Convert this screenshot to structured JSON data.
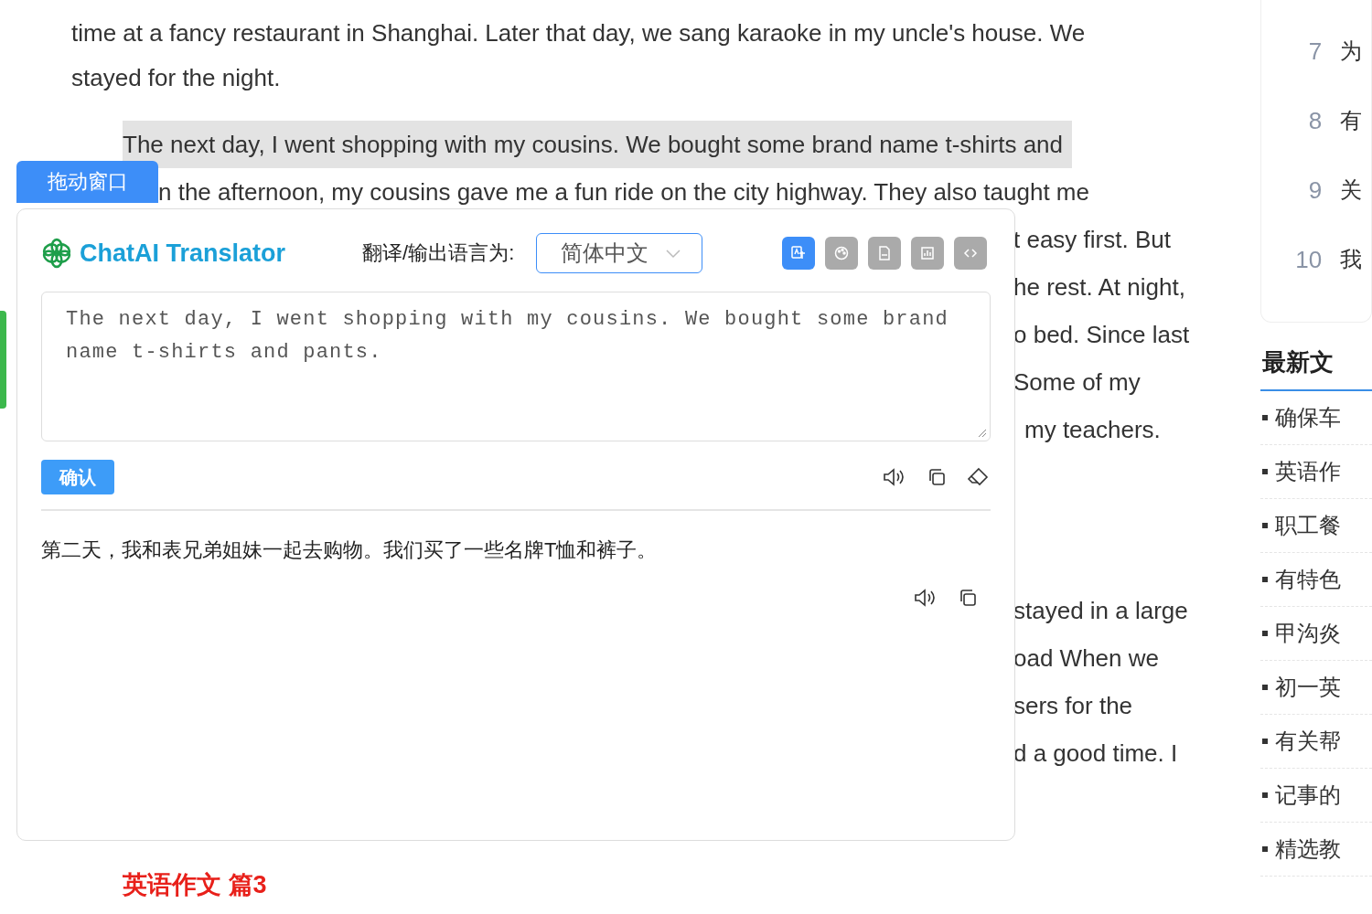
{
  "article": {
    "lines_top": [
      "time at a fancy restaurant in Shanghai. Later that day, we sang karaoke in my uncle's house. We",
      "stayed for the night."
    ],
    "highlighted_line": "The next day, I went shopping with my cousins. We bought some brand name t-shirts and",
    "line_after": "n the afternoon, my cousins gave me a fun ride on the city highway. They also taught me",
    "side_paragraphs": [
      [
        "t easy first. But",
        "he rest. At night,",
        "o bed. Since last",
        "Some of my",
        "my teachers."
      ],
      [
        "stayed in a large",
        "oad When we",
        "sers for the",
        "d a good time. I"
      ]
    ],
    "next_heading": "英语作文 篇3"
  },
  "sidebar": {
    "ranks": [
      {
        "number": "7",
        "title": "为"
      },
      {
        "number": "8",
        "title": "有"
      },
      {
        "number": "9",
        "title": "关"
      },
      {
        "number": "10",
        "title": "我"
      }
    ],
    "latest_title": "最新文",
    "latest": [
      "确保车",
      "英语作",
      "职工餐",
      "有特色",
      "甲沟炎",
      "初一英",
      "有关帮",
      "记事的",
      "精选教"
    ]
  },
  "drag_tab": "拖动窗口",
  "translator": {
    "title": "ChatAI Translator",
    "language_label": "翻译/输出语言为:",
    "language": "简体中文",
    "tools": [
      {
        "kind": "translate",
        "selected": true
      },
      {
        "kind": "palette",
        "selected": false
      },
      {
        "kind": "document",
        "selected": false
      },
      {
        "kind": "chart",
        "selected": false
      },
      {
        "kind": "code",
        "selected": false
      }
    ],
    "input": "The next day, I went shopping with my cousins. We bought some brand name t-shirts and pants.",
    "confirm": "确认",
    "output": "第二天，我和表兄弟姐妹一起去购物。我们买了一些名牌T恤和裤子。"
  }
}
